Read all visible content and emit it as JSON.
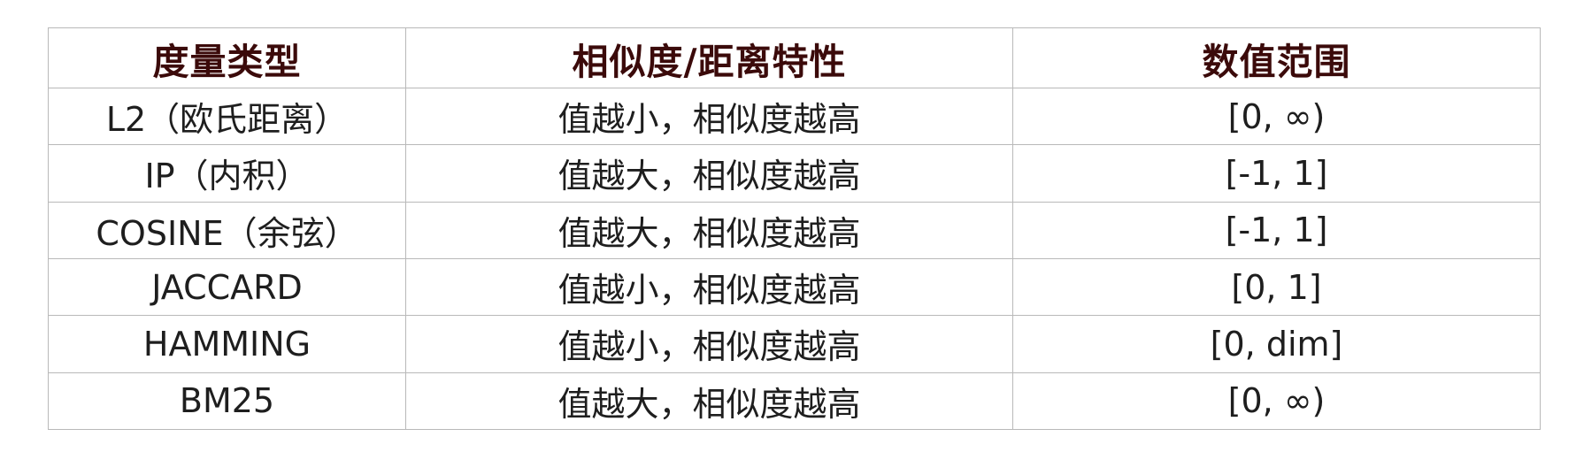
{
  "table": {
    "headers": [
      "度量类型",
      "相似度/距离特性",
      "数值范围"
    ],
    "rows": [
      {
        "metric": "L2（欧氏距离）",
        "trait": "值越小，相似度越高",
        "range": "[0, ∞)"
      },
      {
        "metric": "IP（内积）",
        "trait": "值越大，相似度越高",
        "range": "[-1, 1]"
      },
      {
        "metric": "COSINE（余弦）",
        "trait": "值越大，相似度越高",
        "range": "[-1, 1]"
      },
      {
        "metric": "JACCARD",
        "trait": "值越小，相似度越高",
        "range": "[0, 1]"
      },
      {
        "metric": "HAMMING",
        "trait": "值越小，相似度越高",
        "range": "[0, dim]"
      },
      {
        "metric": "BM25",
        "trait": "值越大，相似度越高",
        "range": "[0, ∞)"
      }
    ]
  },
  "colors": {
    "header_text": "#3b0a0a",
    "body_text": "#1e1e1e",
    "border": "#b9b9b9"
  }
}
